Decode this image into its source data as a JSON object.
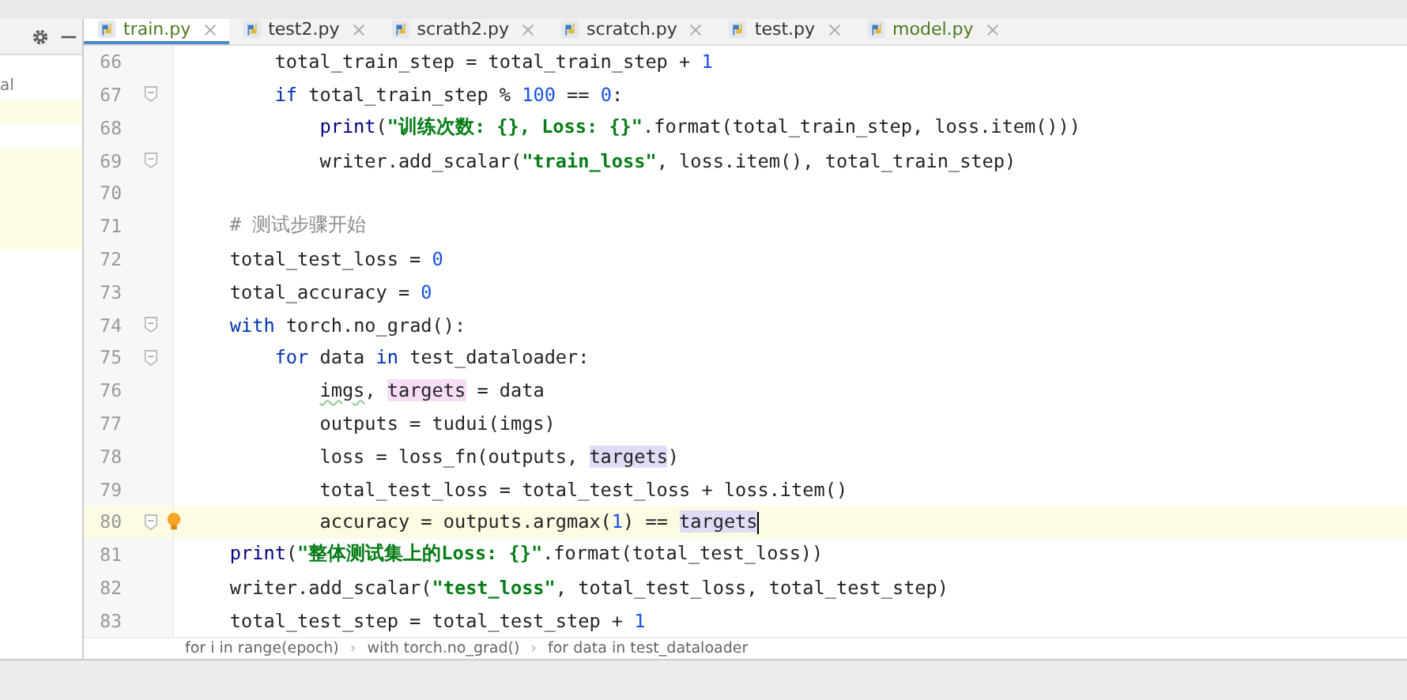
{
  "left_panel": {
    "label": "al"
  },
  "tabs": [
    {
      "label": "train.py",
      "selected": true,
      "modified": true
    },
    {
      "label": "test2.py",
      "selected": false,
      "modified": false
    },
    {
      "label": "scrath2.py",
      "selected": false,
      "modified": false
    },
    {
      "label": "scratch.py",
      "selected": false,
      "modified": false
    },
    {
      "label": "test.py",
      "selected": false,
      "modified": false
    },
    {
      "label": "model.py",
      "selected": false,
      "modified": true
    }
  ],
  "lines": [
    {
      "number": "66",
      "fold": false,
      "current": false,
      "tokens": [
        {
          "kind": "plain",
          "text": "        total_train_step = total_train_step + "
        },
        {
          "kind": "num",
          "text": "1"
        }
      ]
    },
    {
      "number": "67",
      "fold": true,
      "current": false,
      "tokens": [
        {
          "kind": "kw",
          "text": "        if"
        },
        {
          "kind": "plain",
          "text": " total_train_step % "
        },
        {
          "kind": "num",
          "text": "100"
        },
        {
          "kind": "plain",
          "text": " == "
        },
        {
          "kind": "num",
          "text": "0"
        },
        {
          "kind": "plain",
          "text": ":"
        }
      ]
    },
    {
      "number": "68",
      "fold": false,
      "current": false,
      "tokens": [
        {
          "kind": "builtin",
          "text": "            print"
        },
        {
          "kind": "plain",
          "text": "("
        },
        {
          "kind": "str",
          "text": "\"训练次数: {}, Loss: {}\""
        },
        {
          "kind": "plain",
          "text": ".format(total_train_step, loss.item()))"
        }
      ]
    },
    {
      "number": "69",
      "fold": true,
      "current": false,
      "tokens": [
        {
          "kind": "plain",
          "text": "            writer.add_scalar("
        },
        {
          "kind": "str",
          "text": "\"train_loss\""
        },
        {
          "kind": "plain",
          "text": ", loss.item(), total_train_step)"
        }
      ]
    },
    {
      "number": "70",
      "fold": false,
      "current": false
    },
    {
      "number": "71",
      "fold": false,
      "current": false,
      "tokens": [
        {
          "kind": "comment",
          "text": "    # 测试步骤开始"
        }
      ]
    },
    {
      "number": "72",
      "fold": false,
      "current": false,
      "tokens": [
        {
          "kind": "plain",
          "text": "    total_test_loss = "
        },
        {
          "kind": "num",
          "text": "0"
        }
      ]
    },
    {
      "number": "73",
      "fold": false,
      "current": false,
      "tokens": [
        {
          "kind": "plain",
          "text": "    total_accuracy = "
        },
        {
          "kind": "num",
          "text": "0"
        }
      ]
    },
    {
      "number": "74",
      "fold": true,
      "current": false,
      "tokens": [
        {
          "kind": "kw",
          "text": "    with"
        },
        {
          "kind": "plain",
          "text": " torch.no_grad():"
        }
      ]
    },
    {
      "number": "75",
      "fold": true,
      "current": false,
      "tokens": [
        {
          "kind": "kw",
          "text": "        for"
        },
        {
          "kind": "plain",
          "text": " data "
        },
        {
          "kind": "kw",
          "text": "in"
        },
        {
          "kind": "plain",
          "text": " test_dataloader:"
        }
      ]
    },
    {
      "number": "76",
      "fold": false,
      "current": false,
      "tokens": [
        {
          "kind": "weak",
          "text": "            imgs"
        },
        {
          "kind": "plain",
          "text": ", "
        },
        {
          "kind": "write",
          "text": "targets"
        },
        {
          "kind": "plain",
          "text": " = data"
        }
      ]
    },
    {
      "number": "77",
      "fold": false,
      "current": false,
      "tokens": [
        {
          "kind": "plain",
          "text": "            outputs = tudui(imgs)"
        }
      ]
    },
    {
      "number": "78",
      "fold": false,
      "current": false,
      "tokens": [
        {
          "kind": "plain",
          "text": "            loss = loss_fn(outputs, "
        },
        {
          "kind": "read",
          "text": "targets"
        },
        {
          "kind": "plain",
          "text": ")"
        }
      ]
    },
    {
      "number": "79",
      "fold": false,
      "current": false,
      "tokens": [
        {
          "kind": "plain",
          "text": "            total_test_loss = total_test_loss + loss.item()"
        }
      ]
    },
    {
      "number": "80",
      "fold": true,
      "current": true,
      "bulb": true,
      "tokens": [
        {
          "kind": "plain",
          "text": "            accuracy = outputs.argmax("
        },
        {
          "kind": "num",
          "text": "1"
        },
        {
          "kind": "plain",
          "text": ") == "
        },
        {
          "kind": "read",
          "text": "targets"
        }
      ]
    },
    {
      "number": "81",
      "fold": false,
      "current": false,
      "tokens": [
        {
          "kind": "builtin",
          "text": "    print"
        },
        {
          "kind": "plain",
          "text": "("
        },
        {
          "kind": "str",
          "text": "\"整体测试集上的Loss: {}\""
        },
        {
          "kind": "plain",
          "text": ".format(total_test_loss))"
        }
      ]
    },
    {
      "number": "82",
      "fold": false,
      "current": false,
      "tokens": [
        {
          "kind": "plain",
          "text": "    writer.add_scalar("
        },
        {
          "kind": "str",
          "text": "\"test_loss\""
        },
        {
          "kind": "plain",
          "text": ", total_test_loss, total_test_step)"
        }
      ]
    },
    {
      "number": "83",
      "fold": false,
      "current": false,
      "tokens": [
        {
          "kind": "plain",
          "text": "    total_test_step = total_test_step + "
        },
        {
          "kind": "num",
          "text": "1"
        }
      ]
    }
  ],
  "breadcrumbs": [
    "for i in range(epoch)",
    "with torch.no_grad()",
    "for data in test_dataloader"
  ],
  "breadcrumb_separator": "›"
}
